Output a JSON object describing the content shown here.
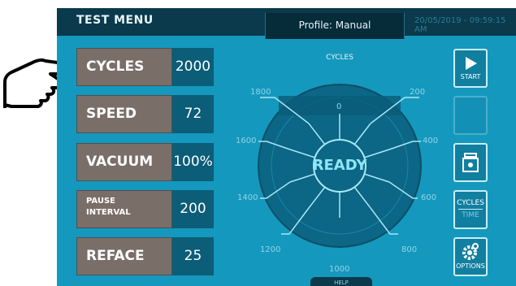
{
  "header": {
    "menu_title": "TEST MENU",
    "profile_label": "Profile:",
    "profile_value": "Manual",
    "datetime": "20/05/2019 - 09:59:15 AM"
  },
  "parameters": [
    {
      "label": "CYCLES",
      "value": "2000"
    },
    {
      "label": "SPEED",
      "value": "72"
    },
    {
      "label": "VACUUM",
      "value": "100%"
    },
    {
      "label_line1": "PAUSE",
      "label_line2": "INTERVAL",
      "value": "200"
    },
    {
      "label": "REFACE",
      "value": "25"
    }
  ],
  "dial": {
    "title": "CYCLES",
    "status": "READY",
    "ticks": [
      "0",
      "200",
      "400",
      "600",
      "800",
      "1000",
      "1200",
      "1400",
      "1600",
      "1800"
    ]
  },
  "side_buttons": {
    "start": "START",
    "cycles": "CYCLES",
    "time": "TIME",
    "options": "OPTIONS"
  },
  "footer": {
    "help": "HELP"
  },
  "colors": {
    "panel_bg": "#1598bd",
    "topbar_bg": "#0a3a4b",
    "label_bg": "#7a6e68",
    "value_bg": "#0b5d78"
  }
}
